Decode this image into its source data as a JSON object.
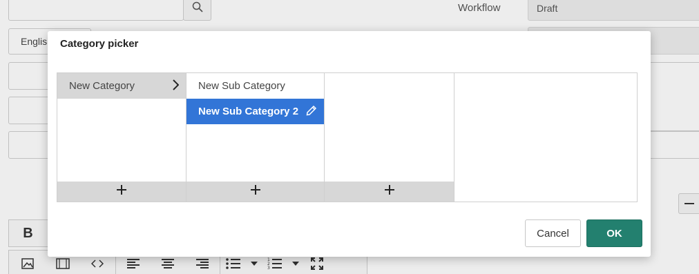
{
  "background": {
    "workflow_label": "Workflow",
    "workflow_value": "Draft",
    "language_value": "English",
    "icons": {
      "search": "search-icon",
      "minus": "minus-icon"
    },
    "toolbar": {
      "bold_label": "B",
      "row2_icons": [
        "image-icon",
        "video-icon",
        "code-icon",
        "align-left-icon",
        "align-center-icon",
        "align-right-icon",
        "bullet-list-icon",
        "dropdown-icon",
        "numbered-list-icon",
        "dropdown-icon",
        "fullscreen-icon"
      ]
    }
  },
  "dialog": {
    "title": "Category picker",
    "columns": [
      {
        "items": [
          {
            "label": "New Category",
            "state": "active",
            "icon": "chevron-right-icon"
          }
        ],
        "add_icon": "plus-icon"
      },
      {
        "items": [
          {
            "label": "New Sub Category",
            "state": "normal"
          },
          {
            "label": "New Sub Category 2",
            "state": "selected",
            "icon": "pencil-icon"
          }
        ],
        "add_icon": "plus-icon"
      },
      {
        "items": [],
        "add_icon": "plus-icon"
      },
      {
        "items": []
      }
    ],
    "buttons": {
      "cancel": "Cancel",
      "ok": "OK"
    },
    "colors": {
      "selected": "#3275d7",
      "ok": "#23806f",
      "active": "#d7d7d7"
    }
  }
}
